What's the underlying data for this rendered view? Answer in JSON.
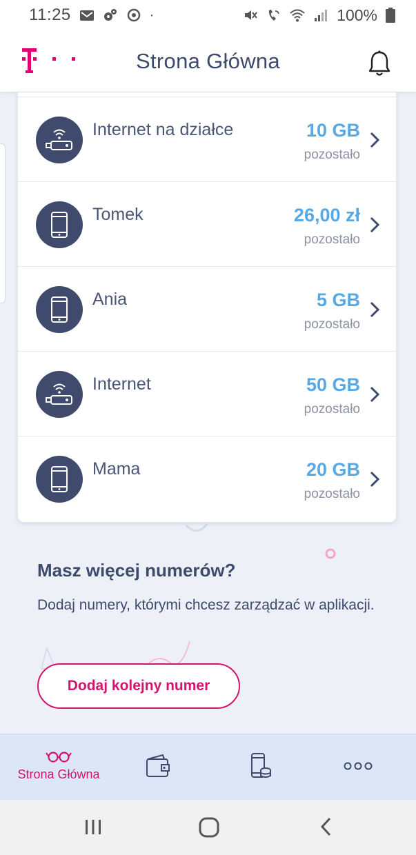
{
  "status_bar": {
    "time": "11:25",
    "battery": "100%",
    "left_icons": [
      "mail-icon",
      "gear-cluster-icon",
      "sync-icon",
      "dot-icon"
    ],
    "right_icons": [
      "mute-icon",
      "wifi-call-icon",
      "wifi-icon",
      "signal-icon",
      "battery-icon"
    ]
  },
  "header": {
    "title": "Strona Główna",
    "brand_color": "#e20074"
  },
  "lines": [
    {
      "name": "Internet na działce",
      "value": "10 GB",
      "sub": "pozostało",
      "icon": "router-icon"
    },
    {
      "name": "Tomek",
      "value": "26,00 zł",
      "sub": "pozostało",
      "icon": "phone-icon"
    },
    {
      "name": "Ania",
      "value": "5 GB",
      "sub": "pozostało",
      "icon": "phone-icon"
    },
    {
      "name": "Internet",
      "value": "50 GB",
      "sub": "pozostało",
      "icon": "router-icon"
    },
    {
      "name": "Mama",
      "value": "20 GB",
      "sub": "pozostało",
      "icon": "phone-icon"
    }
  ],
  "promo": {
    "title": "Masz więcej numerów?",
    "text": "Dodaj numery, którymi chcesz zarządzać w aplikacji.",
    "button_label": "Dodaj kolejny numer"
  },
  "bottom_nav": [
    {
      "label": "Strona Główna",
      "icon": "glasses-icon",
      "active": true
    },
    {
      "label": "",
      "icon": "wallet-icon",
      "active": false
    },
    {
      "label": "",
      "icon": "phone-coins-icon",
      "active": false
    },
    {
      "label": "",
      "icon": "more-icon",
      "active": false
    }
  ],
  "colors": {
    "accent": "#d3136f",
    "value_blue": "#57a9e6",
    "icon_bg": "#3f4a6c",
    "text": "#3d4a6b"
  }
}
